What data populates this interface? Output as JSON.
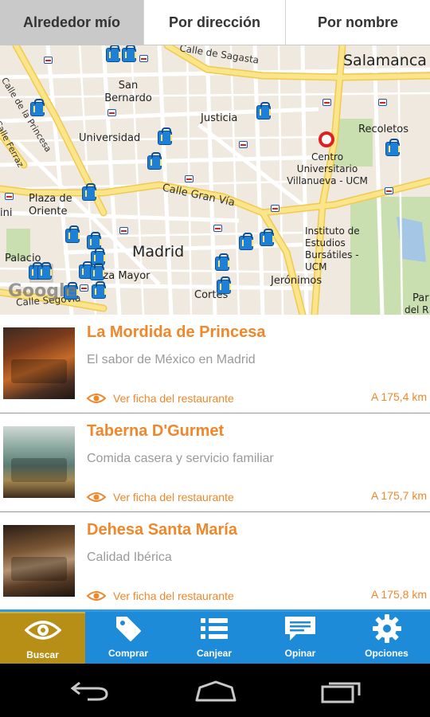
{
  "tabs": [
    {
      "label": "Alrededor mío",
      "active": true
    },
    {
      "label": "Por dirección",
      "active": false
    },
    {
      "label": "Por nombre",
      "active": false
    }
  ],
  "map": {
    "labels": {
      "salamanca": "Salamanca",
      "calle_sagasta": "Calle de Sagasta",
      "san_bernardo": "San Bernardo",
      "justicia": "Justicia",
      "recoletos": "Recoletos",
      "universidad": "Universidad",
      "centro_universitario": "Centro Universitario Villanueva - UCM",
      "calle_gran_via": "Calle Gran Vía",
      "plaza_oriente": "Plaza de Oriente",
      "madrid": "Madrid",
      "instituto": "Instituto de Estudios Bursátiles - UCM",
      "palacio": "Palacio",
      "plaza_mayor": "Plaza Mayor",
      "jeronimos": "Jerónimos",
      "cortes": "Cortes",
      "calle_segovia": "Calle Segovia",
      "calle_princesa": "Calle de la Princesa",
      "calle_ferraz": "Calle Ferraz",
      "google": "Google",
      "paseo_prado_partial": "Par",
      "partial_del_r": "del R",
      "partial_ini": "ini"
    },
    "colors": {
      "land": "#efe9df",
      "major_road": "#fbe58a",
      "road": "#ffffff",
      "park": "#c9dfb0",
      "water": "#a6c6e6"
    }
  },
  "restaurants": [
    {
      "name": "La Mordida de Princesa",
      "description": "El sabor de México en Madrid",
      "link": "Ver ficha del restaurante",
      "distance": "A 175,4 km"
    },
    {
      "name": "Taberna D'Gurmet",
      "description": "Comida casera y servicio familiar",
      "link": "Ver ficha del restaurante",
      "distance": "A 175,7 km"
    },
    {
      "name": "Dehesa Santa María",
      "description": "Calidad Ibérica",
      "link": "Ver ficha del restaurante",
      "distance": "A 175,8 km"
    }
  ],
  "bottom_nav": [
    {
      "label": "Buscar",
      "icon": "eye-icon",
      "active": true
    },
    {
      "label": "Comprar",
      "icon": "tag-icon",
      "active": false
    },
    {
      "label": "Canjear",
      "icon": "list-icon",
      "active": false
    },
    {
      "label": "Opinar",
      "icon": "speech-bubble-icon",
      "active": false
    },
    {
      "label": "Opciones",
      "icon": "gear-icon",
      "active": false
    }
  ],
  "system_bar": {
    "back": "back-icon",
    "home": "home-icon",
    "recents": "recents-icon"
  },
  "accent_colors": {
    "orange": "#f0872a",
    "nav_blue": "#1e8bd8",
    "nav_active": "#b78f17"
  }
}
